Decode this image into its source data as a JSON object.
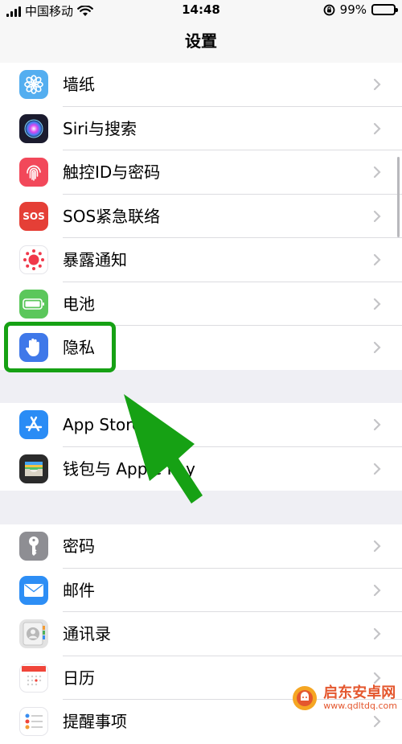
{
  "status_bar": {
    "carrier": "中国移动",
    "time": "14:48",
    "battery_percent": "99%"
  },
  "nav": {
    "title": "设置"
  },
  "groups": [
    {
      "items": [
        {
          "label": "墙纸",
          "icon": "wallpaper-flower-icon",
          "color": "#54aef0"
        },
        {
          "label": "Siri与搜索",
          "icon": "siri-icon",
          "color": "#1b1b2e"
        },
        {
          "label": "触控ID与密码",
          "icon": "fingerprint-icon",
          "color": "#f2485a"
        },
        {
          "label": "SOS紧急联络",
          "icon": "sos-icon",
          "color": "#e53f36",
          "icon_text": "SOS"
        },
        {
          "label": "暴露通知",
          "icon": "exposure-dots-icon",
          "color": "#ffffff"
        },
        {
          "label": "电池",
          "icon": "battery-icon",
          "color": "#5bc75b"
        },
        {
          "label": "隐私",
          "icon": "hand-icon",
          "color": "#3f78e9"
        }
      ]
    },
    {
      "items": [
        {
          "label": "App Store",
          "icon": "app-store-icon",
          "color": "#2a8cf5"
        },
        {
          "label": "钱包与 Apple Pay",
          "icon": "wallet-icon",
          "color": "#2b2b2b"
        }
      ]
    },
    {
      "items": [
        {
          "label": "密码",
          "icon": "key-icon",
          "color": "#8e8e93"
        },
        {
          "label": "邮件",
          "icon": "mail-icon",
          "color": "#2d8ef5"
        },
        {
          "label": "通讯录",
          "icon": "contacts-icon",
          "color": "#bdbdbd"
        },
        {
          "label": "日历",
          "icon": "calendar-icon",
          "color": "#ffffff"
        },
        {
          "label": "提醒事项",
          "icon": "reminders-icon",
          "color": "#ffffff"
        }
      ]
    }
  ],
  "annotation": {
    "highlight_color": "#16a114",
    "arrow_color": "#16a114"
  },
  "watermark": {
    "name": "启东安卓网",
    "url": "www.qdltdq.com"
  }
}
